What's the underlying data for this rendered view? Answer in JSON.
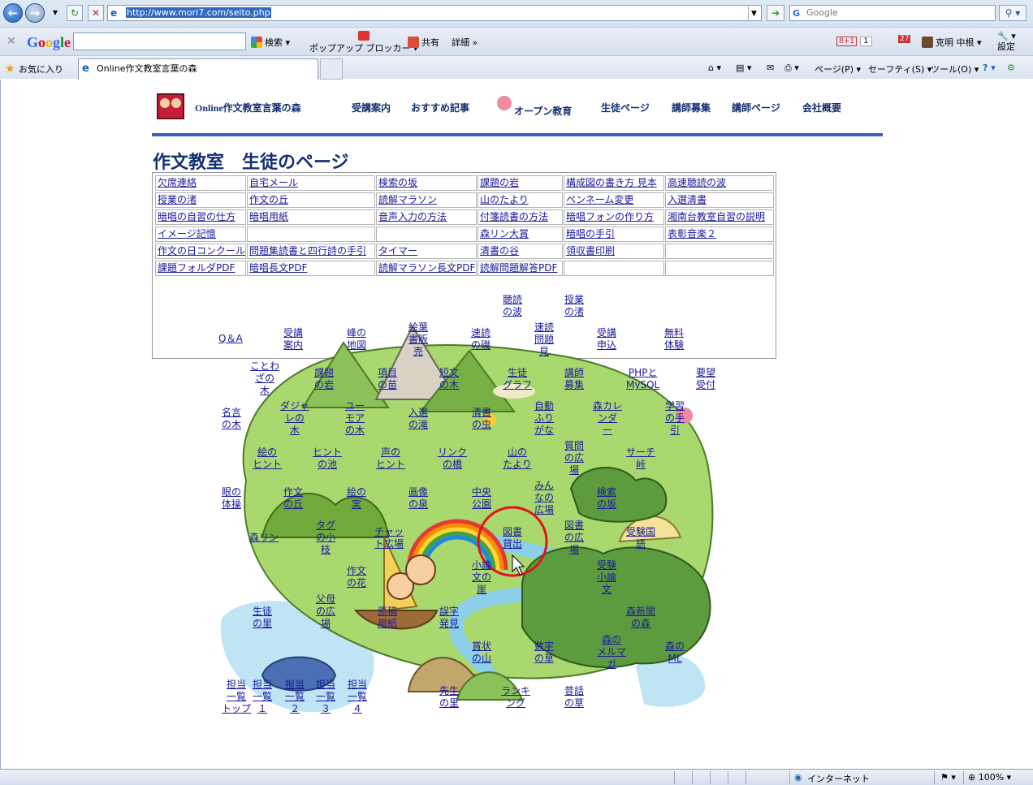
{
  "browser": {
    "address_url": "http://www.mori7.com/seito.php",
    "search_placeholder": "Google",
    "toolbar": {
      "google_logo": "Google",
      "search_label": "検索",
      "popup_blocker_label_1": "ポップアップ",
      "popup_blocker_label_2": "ブロッカー",
      "share_label": "共有",
      "details_label": "詳細",
      "plus_one": "8+1",
      "plus_one_count": "1",
      "user_name": "克明 中根",
      "settings_label": "設定",
      "notification_count": "27"
    },
    "favorites_label": "お気に入り",
    "tab_title": "Online作文教室言葉の森",
    "commands": {
      "page": "ページ(P)",
      "safety": "セーフティ(S)",
      "tools": "ツール(O)"
    },
    "status": {
      "zone": "インターネット",
      "zoom": "100%"
    }
  },
  "site": {
    "name": "Online作文教室言葉の森",
    "nav": [
      "受講案内",
      "おすすめ記事",
      "オープン教育",
      "生徒ページ",
      "講師募集",
      "講師ページ",
      "会社概要"
    ],
    "page_title": "作文教室　生徒のページ"
  },
  "links_table": {
    "rows": [
      [
        "欠席連絡",
        "自宅メール",
        "検索の坂",
        "課題の岩",
        "構成図の書き方 見本",
        "高速聴読の波"
      ],
      [
        "授業の渚",
        "作文の丘",
        "読解マラソン",
        "山のたより",
        "ペンネーム変更",
        "入選清書"
      ],
      [
        "暗唱の自習の仕方",
        "暗唱用紙",
        "音声入力の方法",
        "付箋読書の方法",
        "暗唱フォンの作り方",
        "湘南台教室自習の説明"
      ],
      [
        "イメージ記憶",
        "",
        "",
        "森リン大賞",
        "暗唱の手引",
        "表彰音楽２"
      ],
      [
        "作文の日コンクール",
        "問題集読書と四行詩の手引",
        "タイマー",
        "清書の谷",
        "領収書印刷",
        ""
      ],
      [
        "課題フォルダPDF",
        "暗唱長文PDF",
        "読解マラソン長文PDF",
        "読解問題解答PDF",
        "",
        ""
      ]
    ]
  },
  "map_links": [
    "聴読\nの波",
    "授業\nの渚",
    "Q＆A",
    "受講\n案内",
    "峰の\n地図",
    "絵葉\n書販\n売",
    "速読\nの磯",
    "速読\n問題\n見",
    "受講\n申込",
    "無料\n体験",
    "ことわ\nざの\n木",
    "課題\nの岩",
    "項目\nの苗",
    "短文\nの木",
    "生徒\nグラフ",
    "講師\n募集",
    "PHPと\nMySQL",
    "要望\n受付",
    "名言\nの木",
    "ダジャ\nレの\n木",
    "ユー\nモア\nの木",
    "入選\nの滝",
    "清書\nの虫",
    "自動\nふり\nがな",
    "森カレ\nンダ\nー",
    "学習\nの手\n引",
    "絵の\nヒント",
    "ヒント\nの池",
    "声の\nヒント",
    "リンク\nの橋",
    "山の\nたより",
    "質問\nの広\n場",
    "サーチ\n峠",
    "眼の\n体操",
    "作文\nの丘",
    "絵の\n実",
    "画像\nの泉",
    "中央\n公園",
    "みん\nなの\n広場",
    "検索\nの坂",
    "森リン",
    "タグ\nの小\n枝",
    "チャッ\nト広場",
    "図書\n貸出",
    "図書\nの広\n場",
    "受験国\n語",
    "小論\n文の\n崖",
    "受験\n小論\n文",
    "作文\nの花",
    "生徒\nの里",
    "父母\nの広\n場",
    "原稿\n用紙",
    "誤字\n発見",
    "森新聞\nの森",
    "森の\nメルマ\nガ",
    "森の\nML",
    "賞状\nの山",
    "数字\nの草",
    "担当\n一覧\nトップ",
    "担当\n一覧\n１",
    "担当\n一覧\n２",
    "担当\n一覧\n３",
    "担当\n一覧\n４",
    "先生\nの里",
    "ランキ\nング",
    "昔話\nの草"
  ],
  "colors": {
    "nav_text": "#142f72",
    "link": "#1a1a9e",
    "header_rule": "#3c5fc0",
    "highlight_circle": "#e0141b"
  }
}
